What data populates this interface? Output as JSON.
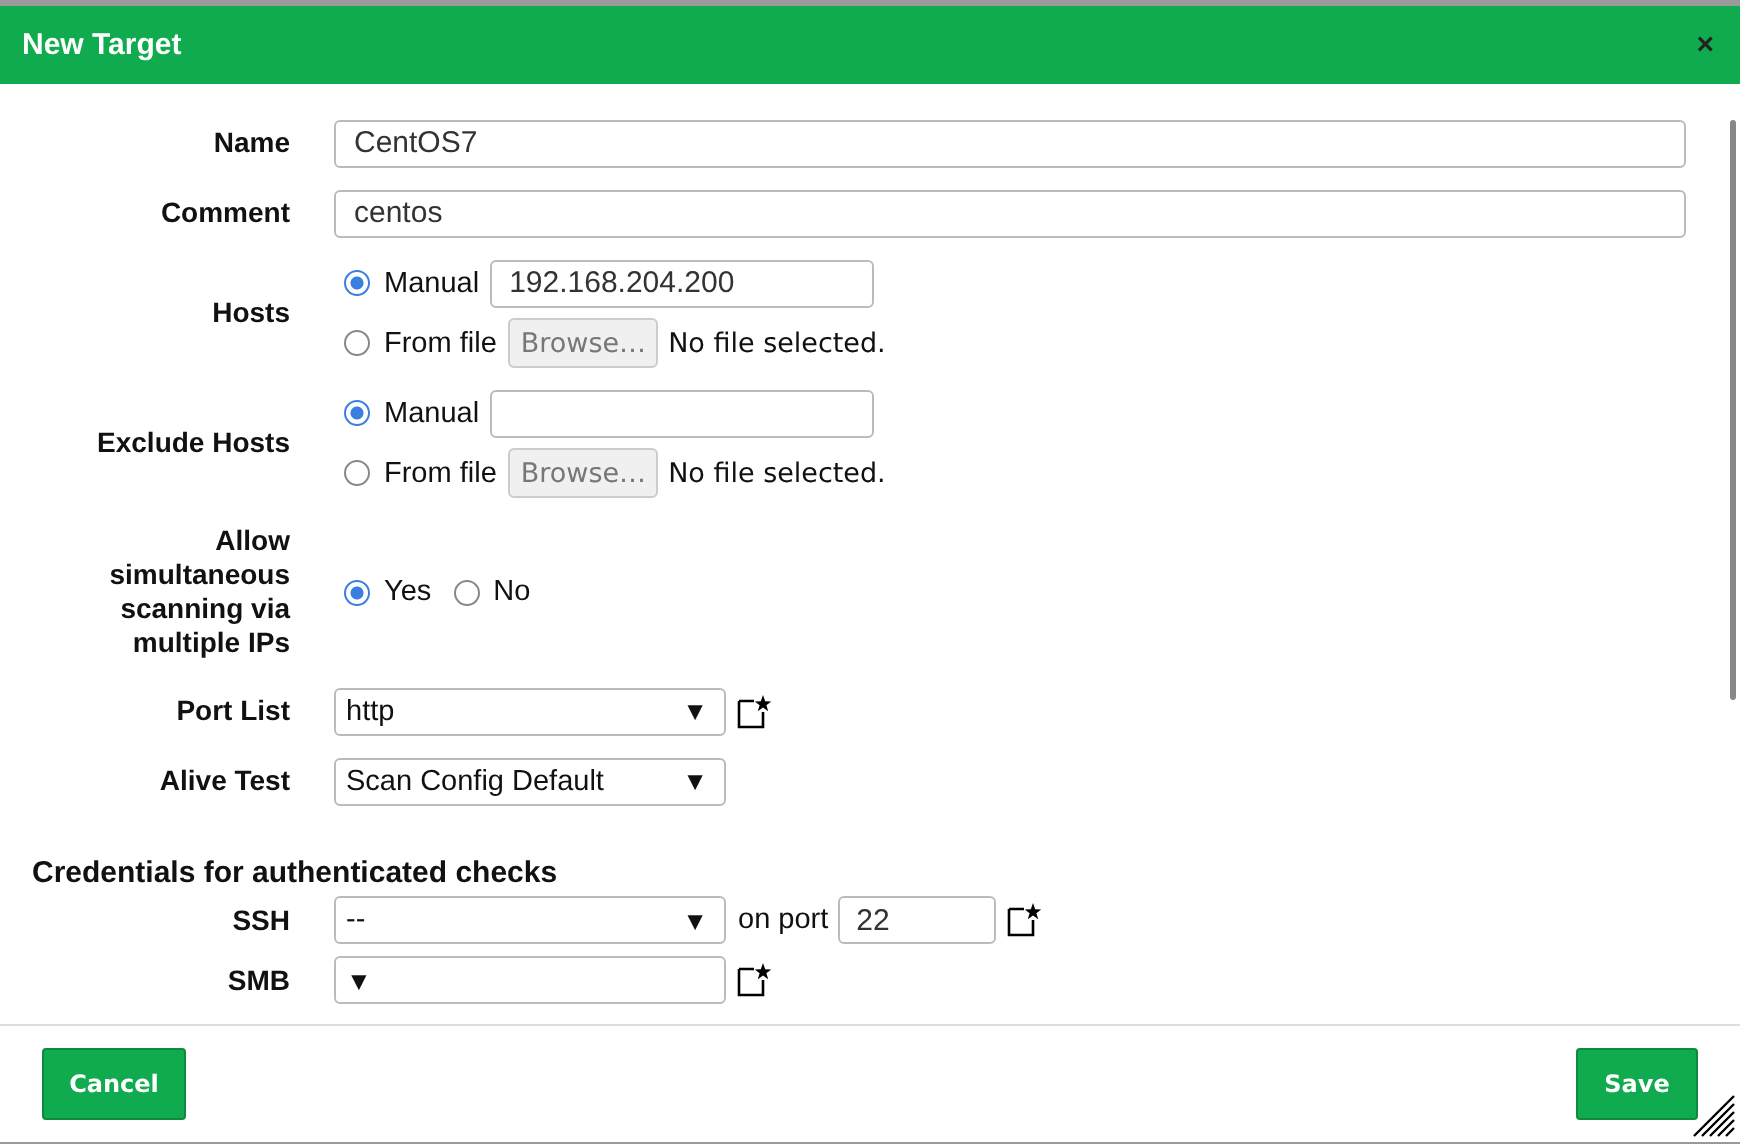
{
  "window": {
    "title": "New Target",
    "close": "×"
  },
  "fields": [
    {
      "kind": "text",
      "label": "Name",
      "value": "CentOS7"
    },
    {
      "kind": "text",
      "label": "Comment",
      "value": "centos"
    },
    {
      "kind": "source",
      "label": "Hosts",
      "options": [
        {
          "kind": "manual",
          "label": "Manual",
          "selected": true,
          "value": "192.168.204.200"
        },
        {
          "kind": "file",
          "label": "From file",
          "selected": false,
          "browse": "Browse…",
          "status": "No file selected."
        }
      ]
    },
    {
      "kind": "source",
      "label": "Exclude Hosts",
      "options": [
        {
          "kind": "manual",
          "label": "Manual",
          "selected": true
        },
        {
          "kind": "file",
          "label": "From file",
          "selected": false,
          "browse": "Browse…",
          "status": "No file selected."
        }
      ]
    },
    {
      "kind": "radio",
      "label": "Allow simultaneous scanning via multiple IPs",
      "options": [
        {
          "label": "Yes",
          "selected": true
        },
        {
          "label": "No",
          "selected": false
        }
      ]
    },
    {
      "kind": "select",
      "label": "Port List",
      "value": "http",
      "caret": "▼",
      "new_button": true
    },
    {
      "kind": "select",
      "label": "Alive Test",
      "value": "Scan Config Default",
      "caret": "▼",
      "new_button": false
    }
  ],
  "credentials": {
    "title": "Credentials for authenticated checks",
    "rows": [
      {
        "label": "SSH",
        "value": "--",
        "caret": "▼",
        "port_label": "on port",
        "port": "22",
        "new_button": true
      },
      {
        "label": "SMB",
        "caret": "▼",
        "new_button": true
      }
    ]
  },
  "buttons": [
    {
      "label": "Cancel"
    },
    {
      "label": "Save"
    }
  ]
}
